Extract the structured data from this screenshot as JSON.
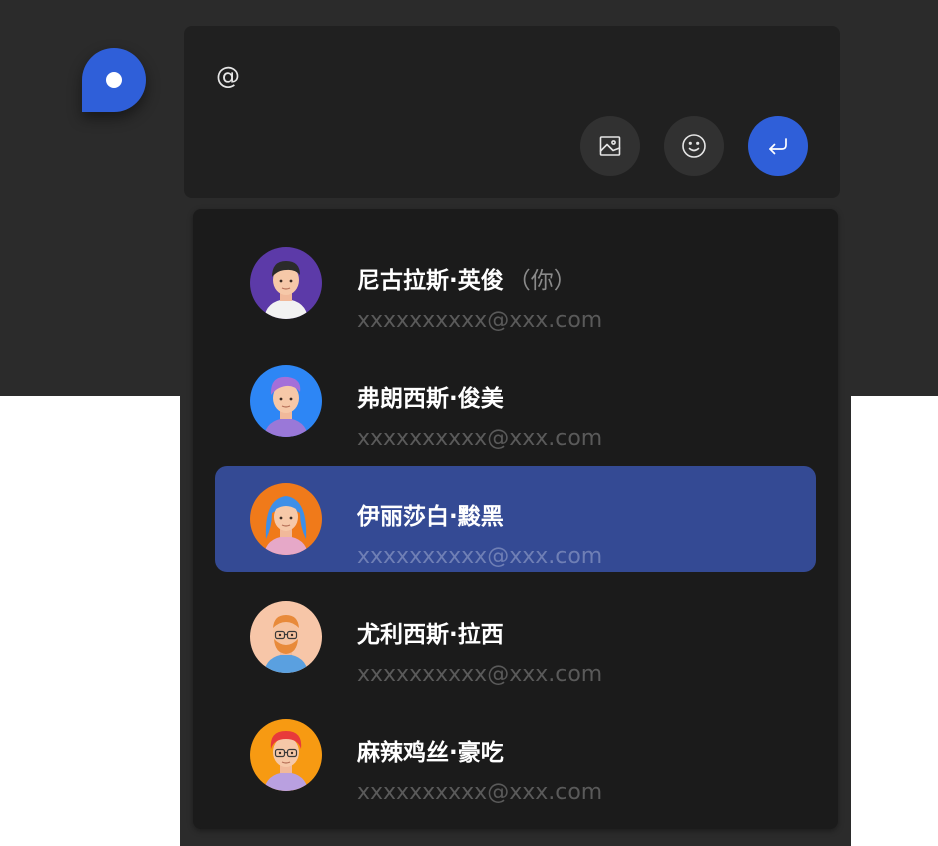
{
  "composer": {
    "input_value": "@"
  },
  "toolbar": {
    "image_icon": "image-icon",
    "emoji_icon": "emoji-icon",
    "send_icon": "enter-arrow-icon"
  },
  "colors": {
    "accent": "#2f5fd9",
    "selected_row": "#344a94",
    "panel": "#1b1b1b",
    "background": "#2b2b2b"
  },
  "mention_list": {
    "you_tag": "（你）",
    "users": [
      {
        "name": "尼古拉斯·英俊",
        "email": "xxxxxxxxxx@xxx.com",
        "is_you": true
      },
      {
        "name": "弗朗西斯·俊美",
        "email": "xxxxxxxxxx@xxx.com"
      },
      {
        "name": "伊丽莎白·黢黑",
        "email": "xxxxxxxxxx@xxx.com",
        "selected": true
      },
      {
        "name": "尤利西斯·拉西",
        "email": "xxxxxxxxxx@xxx.com"
      },
      {
        "name": "麻辣鸡丝·豪吃",
        "email": "xxxxxxxxxx@xxx.com"
      }
    ]
  }
}
